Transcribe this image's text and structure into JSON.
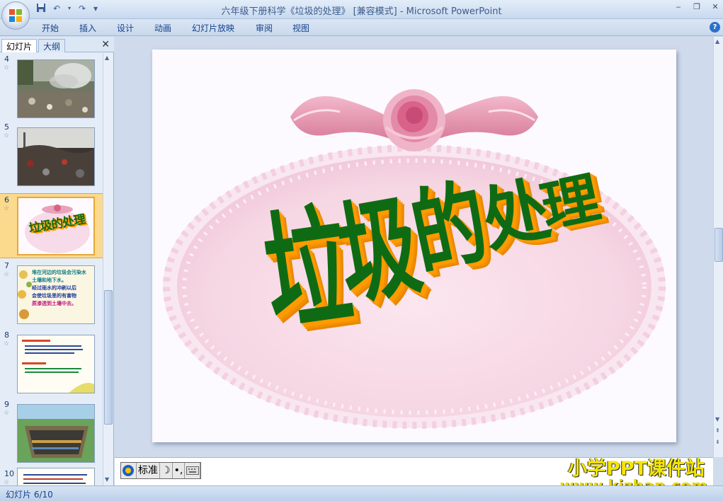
{
  "window": {
    "title": "六年级下册科学《垃圾的处理》 [兼容模式] - Microsoft PowerPoint"
  },
  "quick_access": {
    "save_icon": "save-icon",
    "undo_glyph": "↶",
    "redo_glyph": "↷",
    "customize_glyph": "▾"
  },
  "window_controls": {
    "minimize": "‒",
    "restore": "❐",
    "close": "✕"
  },
  "ribbon": {
    "tabs": [
      "开始",
      "插入",
      "设计",
      "动画",
      "幻灯片放映",
      "审阅",
      "视图"
    ],
    "help": "?"
  },
  "left_panel": {
    "tabs": {
      "slides": "幻灯片",
      "outline": "大纲"
    },
    "close": "✕",
    "thumbnails": [
      {
        "number": "4",
        "star": "☆",
        "kind": "photo-smoke"
      },
      {
        "number": "5",
        "star": "☆",
        "kind": "photo-dump"
      },
      {
        "number": "6",
        "star": "☆",
        "kind": "title",
        "text": "垃圾的处理",
        "selected": true
      },
      {
        "number": "7",
        "star": "☆",
        "kind": "text-flowers",
        "lines": [
          "堆在河边的垃圾会污染水",
          "土壤和地下水。",
          "经过雨水的冲刷以后",
          "会使垃圾里的有害物",
          "质渗透到土壤中去。"
        ]
      },
      {
        "number": "8",
        "star": "☆",
        "kind": "text-plain"
      },
      {
        "number": "9",
        "star": "☆",
        "kind": "diagram-landfill"
      },
      {
        "number": "10",
        "star": "☆",
        "kind": "text-list"
      }
    ]
  },
  "slide": {
    "title": "垃圾的处理",
    "title_chars": [
      "垃",
      "圾",
      "的",
      "处",
      "理"
    ],
    "colors": {
      "text": "#0f6b13",
      "extrude": "#ff9b00",
      "lace": "#f3cfe0",
      "ribbon": "#dd8ca8"
    }
  },
  "ime_bar": {
    "icon": "ime-logo-icon",
    "mode": "标准",
    "moon": "☽",
    "punct": "•,",
    "keyboard": "keyboard-icon"
  },
  "watermark": {
    "line1": "小学PPT课件站",
    "line2": "www.kjzhan.com"
  },
  "status": {
    "slide_info": "幻灯片 6/10"
  }
}
